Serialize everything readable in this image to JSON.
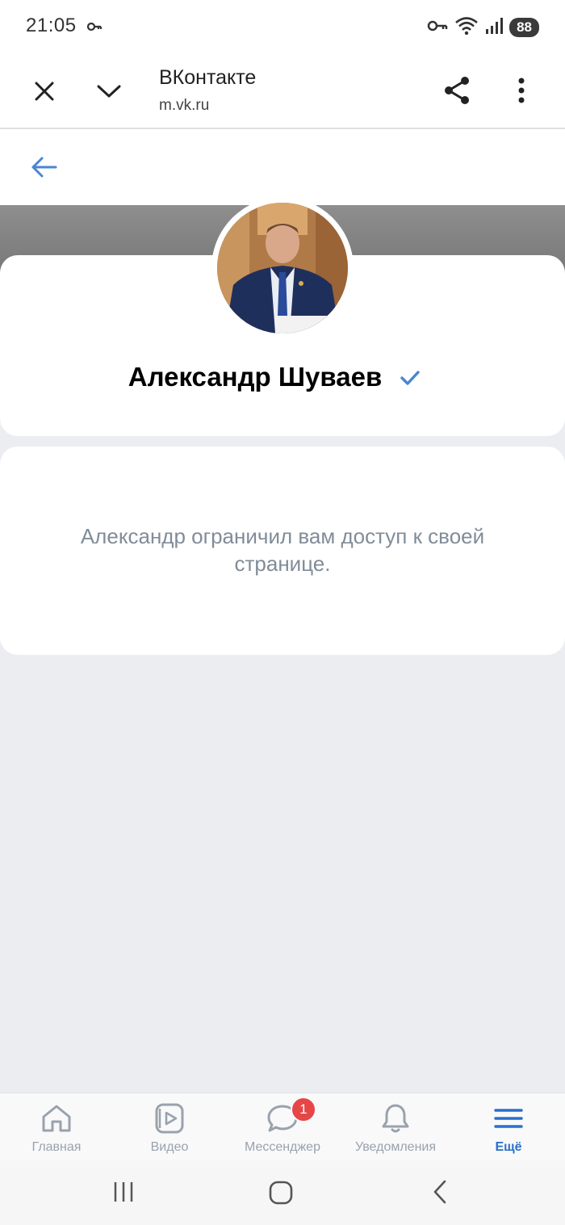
{
  "status_bar": {
    "time": "21:05",
    "battery": "88"
  },
  "browser": {
    "title": "ВКонтакте",
    "url": "m.vk.ru"
  },
  "profile": {
    "name": "Александр Шуваев",
    "restriction_message": "Александр ограничил вам доступ к своей странице."
  },
  "tabbar": {
    "items": [
      {
        "label": "Главная",
        "icon": "home-icon"
      },
      {
        "label": "Видео",
        "icon": "video-icon"
      },
      {
        "label": "Мессенджер",
        "icon": "messenger-icon",
        "badge": "1"
      },
      {
        "label": "Уведомления",
        "icon": "bell-icon"
      },
      {
        "label": "Ещё",
        "icon": "menu-icon",
        "active": true
      }
    ]
  },
  "colors": {
    "accent": "#2a6fc9",
    "background": "#ebedf0",
    "secondary_text": "#818c99",
    "badge": "#e64646"
  }
}
